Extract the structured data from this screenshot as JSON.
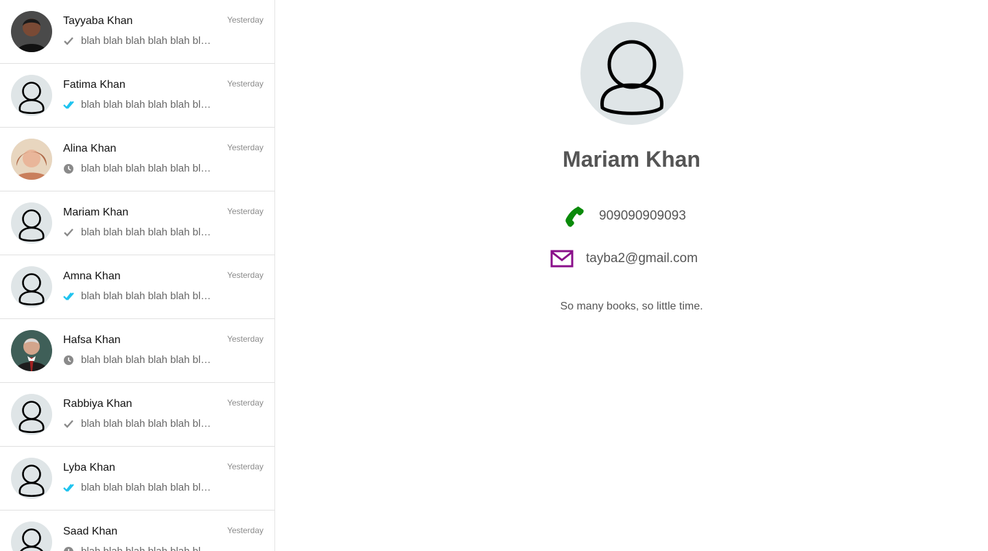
{
  "contacts": [
    {
      "name": "Tayyaba Khan",
      "time": "Yesterday",
      "preview": "blah blah blah blah blah blah blah",
      "status": "sent",
      "avatar": "photo-dark"
    },
    {
      "name": "Fatima Khan",
      "time": "Yesterday",
      "preview": "blah blah blah blah blah blah blah",
      "status": "read",
      "avatar": "default"
    },
    {
      "name": "Alina Khan",
      "time": "Yesterday",
      "preview": "blah blah blah blah blah blah blah",
      "status": "pending",
      "avatar": "photo-warm"
    },
    {
      "name": "Mariam Khan",
      "time": "Yesterday",
      "preview": "blah blah blah blah blah blah blah",
      "status": "sent",
      "avatar": "default"
    },
    {
      "name": "Amna Khan",
      "time": "Yesterday",
      "preview": "blah blah blah blah blah blah blah",
      "status": "read",
      "avatar": "default"
    },
    {
      "name": "Hafsa Khan",
      "time": "Yesterday",
      "preview": "blah blah blah blah blah blah blah",
      "status": "pending",
      "avatar": "photo-suit"
    },
    {
      "name": "Rabbiya Khan",
      "time": "Yesterday",
      "preview": "blah blah blah blah blah blah blah",
      "status": "sent",
      "avatar": "default"
    },
    {
      "name": "Lyba Khan",
      "time": "Yesterday",
      "preview": "blah blah blah blah blah blah blah",
      "status": "read",
      "avatar": "default"
    },
    {
      "name": "Saad Khan",
      "time": "Yesterday",
      "preview": "blah blah blah blah blah blah blah",
      "status": "pending",
      "avatar": "default"
    }
  ],
  "profile": {
    "name": "Mariam Khan",
    "phone": "909090909093",
    "email": "tayba2@gmail.com",
    "status": "So many books, so little time."
  },
  "colors": {
    "phone_icon": "#0a8a0a",
    "email_icon": "#8a0f8a",
    "read_tick": "#1ec3ef",
    "sent_tick": "#8a8a8a",
    "avatar_bg": "#dfe5e7"
  },
  "icons": {
    "phone": "phone-icon",
    "email": "envelope-icon",
    "sent": "single-check-icon",
    "read": "double-check-icon",
    "pending": "clock-icon"
  }
}
